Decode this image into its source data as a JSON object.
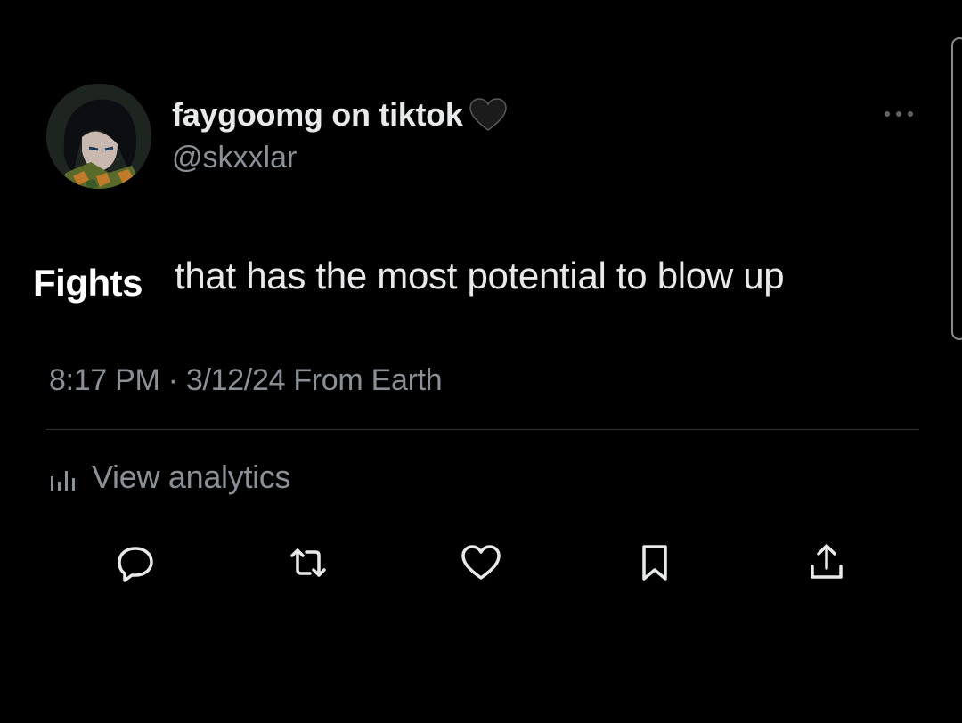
{
  "post": {
    "display_name": "faygoomg on tiktok",
    "name_badge_icon": "black-heart-icon",
    "handle": "@skxxlar",
    "more_icon": "more-horizontal-icon",
    "overlay_word": "Fights",
    "text": "that has the most potential to blow up",
    "meta": "8:17 PM · 3/12/24 From Earth",
    "analytics": {
      "icon": "bar-chart-icon",
      "label": "View analytics"
    },
    "actions": [
      {
        "name": "reply",
        "icon": "reply-icon"
      },
      {
        "name": "repost",
        "icon": "repost-icon"
      },
      {
        "name": "like",
        "icon": "heart-icon"
      },
      {
        "name": "bookmark",
        "icon": "bookmark-icon"
      },
      {
        "name": "share",
        "icon": "share-icon"
      }
    ]
  },
  "colors": {
    "background": "#000000",
    "primary_text": "#e7e9ea",
    "secondary_text": "#8b9096",
    "divider": "#2f3336"
  }
}
